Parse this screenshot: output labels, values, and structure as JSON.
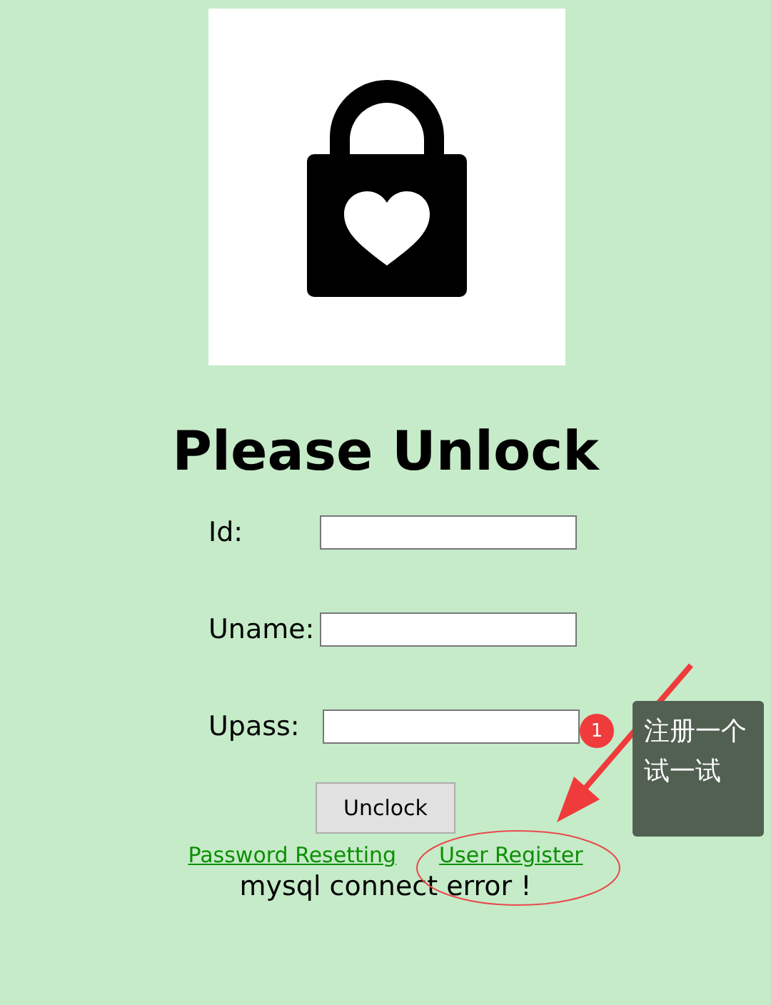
{
  "title": "Please Unlock",
  "fields": [
    {
      "label": "Id:"
    },
    {
      "label": "Uname:"
    },
    {
      "label": "Upass:"
    }
  ],
  "button": "Unclock",
  "links": [
    "Password Resetting",
    "User Register"
  ],
  "error": "mysql connect error !",
  "annotation": {
    "badge": "1",
    "tooltip": "注册一个试一试"
  }
}
